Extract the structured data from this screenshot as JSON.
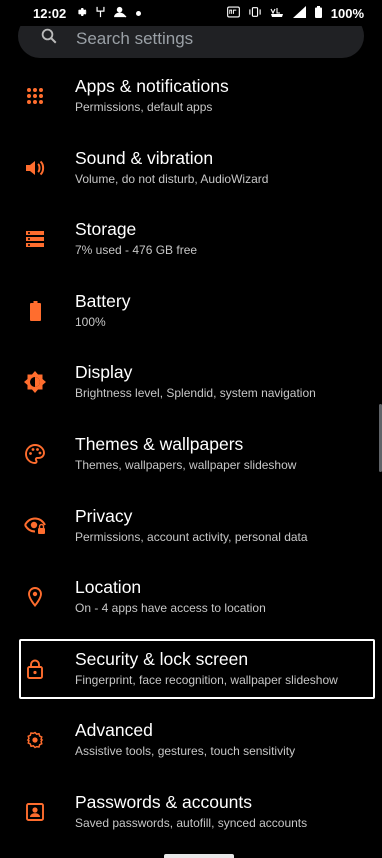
{
  "status_bar": {
    "time": "12:02",
    "battery": "100%",
    "left_icons": [
      "gear-icon",
      "usb-icon",
      "person-icon",
      "dot-icon"
    ],
    "right_icons": [
      "nfc-icon",
      "vibrate-icon",
      "volte-icon",
      "signal-icon",
      "battery-icon"
    ]
  },
  "search": {
    "placeholder": "Search settings"
  },
  "accent_color": "#ff6d2e",
  "items": [
    {
      "title": "Apps & notifications",
      "subtitle": "Permissions, default apps",
      "icon": "apps-grid-icon"
    },
    {
      "title": "Sound & vibration",
      "subtitle": "Volume, do not disturb, AudioWizard",
      "icon": "speaker-icon"
    },
    {
      "title": "Storage",
      "subtitle": "7% used - 476 GB free",
      "icon": "storage-icon"
    },
    {
      "title": "Battery",
      "subtitle": "100%",
      "icon": "battery-full-icon"
    },
    {
      "title": "Display",
      "subtitle": "Brightness level, Splendid, system navigation",
      "icon": "brightness-icon"
    },
    {
      "title": "Themes & wallpapers",
      "subtitle": "Themes, wallpapers, wallpaper slideshow",
      "icon": "palette-icon"
    },
    {
      "title": "Privacy",
      "subtitle": "Permissions, account activity, personal data",
      "icon": "privacy-eye-icon"
    },
    {
      "title": "Location",
      "subtitle": "On - 4 apps have access to location",
      "icon": "location-pin-icon"
    },
    {
      "title": "Security & lock screen",
      "subtitle": "Fingerprint, face recognition, wallpaper slideshow",
      "icon": "lock-icon"
    },
    {
      "title": "Advanced",
      "subtitle": "Assistive tools, gestures, touch sensitivity",
      "icon": "advanced-gear-icon"
    },
    {
      "title": "Passwords & accounts",
      "subtitle": "Saved passwords, autofill, synced accounts",
      "icon": "account-box-icon"
    }
  ]
}
